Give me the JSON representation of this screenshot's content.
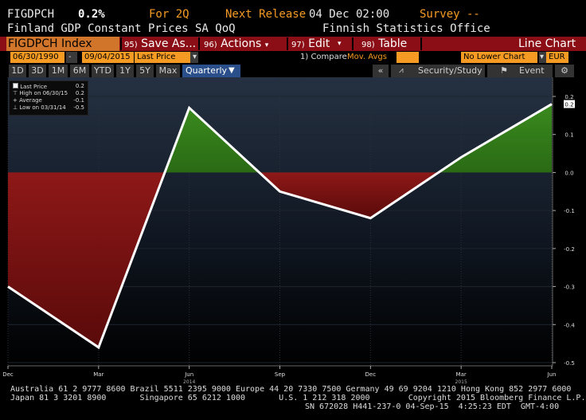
{
  "header": {
    "ticker": "FIGDPCH",
    "value": "0.2%",
    "period_label": "For 2Q",
    "next_release_label": "Next Release",
    "next_release_value": "04 Dec 02:00",
    "survey_label": "Survey --",
    "description": "Finland GDP Constant Prices SA QoQ",
    "source": "Finnish Statistics Office"
  },
  "function_bar": {
    "index_label": "FIGDPCH Index",
    "save_num": "95)",
    "save_label": "Save As...",
    "actions_num": "96)",
    "actions_label": "Actions",
    "edit_num": "97)",
    "edit_label": "Edit",
    "table_num": "98)",
    "table_label": "Table",
    "chart_type": "Line Chart"
  },
  "date_row": {
    "start": "06/30/1990",
    "dash": "-",
    "end": "09/04/2015",
    "field": "Last Price",
    "compare_label": "1) Compare",
    "compare_value": "Mov. Avgs",
    "lower_chart": "No Lower Chart",
    "currency": "EUR"
  },
  "toolbar": {
    "ranges": [
      "1D",
      "3D",
      "1M",
      "6M",
      "YTD",
      "1Y",
      "5Y",
      "Max"
    ],
    "period": "Quarterly",
    "collapse": "«",
    "security_study": "Security/Study",
    "event": "Event"
  },
  "legend": {
    "last_price_label": "Last Price",
    "last_price_value": "0.2",
    "high_label": "High on 06/30/15",
    "high_value": "0.2",
    "average_label": "Average",
    "average_value": "-0.1",
    "low_label": "Low on 03/31/14",
    "low_value": "-0.5"
  },
  "chart_data": {
    "type": "line",
    "x": [
      "Dec 2013",
      "Mar 2014",
      "Jun 2014",
      "Sep 2014",
      "Dec 2014",
      "Mar 2015",
      "Jun 2015"
    ],
    "values": [
      -0.3,
      -0.46,
      0.17,
      -0.05,
      -0.12,
      0.04,
      0.18
    ],
    "series": [
      {
        "values": [
          -0.3,
          -0.46,
          0.17,
          -0.05,
          -0.12,
          0.04,
          0.18
        ]
      }
    ],
    "ylim": [
      -0.5,
      0.2
    ],
    "y_ticks": [
      "0.2",
      "0.1",
      "0.0",
      "-0.1",
      "-0.2",
      "-0.3",
      "-0.4",
      "-0.5"
    ],
    "x_tick_labels": [
      "Dec",
      "Mar",
      "Jun",
      "Sep",
      "Dec",
      "Mar",
      "Jun"
    ],
    "x_year_labels": [
      "2014",
      "2015"
    ],
    "last_value_badge": "0.2",
    "positive_color": "#3a8a1e",
    "negative_color": "#8e1818",
    "line_color": "#ffffff"
  },
  "footer": {
    "line1": "Australia 61 2 9777 8600 Brazil 5511 2395 9000 Europe 44 20 7330 7500 Germany 49 69 9204 1210 Hong Kong 852 2977 6000",
    "line2": "Japan 81 3 3201 8900       Singapore 65 6212 1000       U.S. 1 212 318 2000        Copyright 2015 Bloomberg Finance L.P.",
    "line3": "SN 672028 H441-237-0 04-Sep-15  4:25:23 EDT  GMT-4:00"
  }
}
